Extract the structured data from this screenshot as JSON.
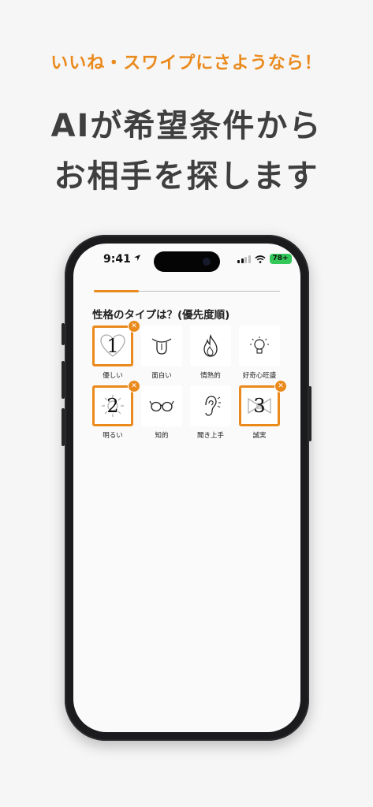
{
  "tagline": "いいね・スワイプにさようなら！",
  "headline": {
    "line1": "AIが希望条件から",
    "line2": "お相手を探します"
  },
  "status_bar": {
    "time": "9:41",
    "battery": "78+"
  },
  "progress": {
    "fraction": 0.24
  },
  "question": "性格のタイプは？(優先度順)",
  "options": [
    {
      "label": "優しい",
      "icon": "heart-icon",
      "selected": true,
      "rank": "1"
    },
    {
      "label": "面白い",
      "icon": "tongue-face-icon",
      "selected": false,
      "rank": ""
    },
    {
      "label": "情熱的",
      "icon": "flame-icon",
      "selected": false,
      "rank": ""
    },
    {
      "label": "好奇心旺盛",
      "icon": "lightbulb-icon",
      "selected": false,
      "rank": ""
    },
    {
      "label": "明るい",
      "icon": "sun-icon",
      "selected": true,
      "rank": "2"
    },
    {
      "label": "知的",
      "icon": "glasses-icon",
      "selected": false,
      "rank": ""
    },
    {
      "label": "聞き上手",
      "icon": "ear-icon",
      "selected": false,
      "rank": ""
    },
    {
      "label": "誠実",
      "icon": "bow-icon",
      "selected": true,
      "rank": "3"
    }
  ],
  "colors": {
    "accent": "#ea8a1d",
    "headline": "#3f3f3f",
    "background": "#f6f6f6"
  }
}
